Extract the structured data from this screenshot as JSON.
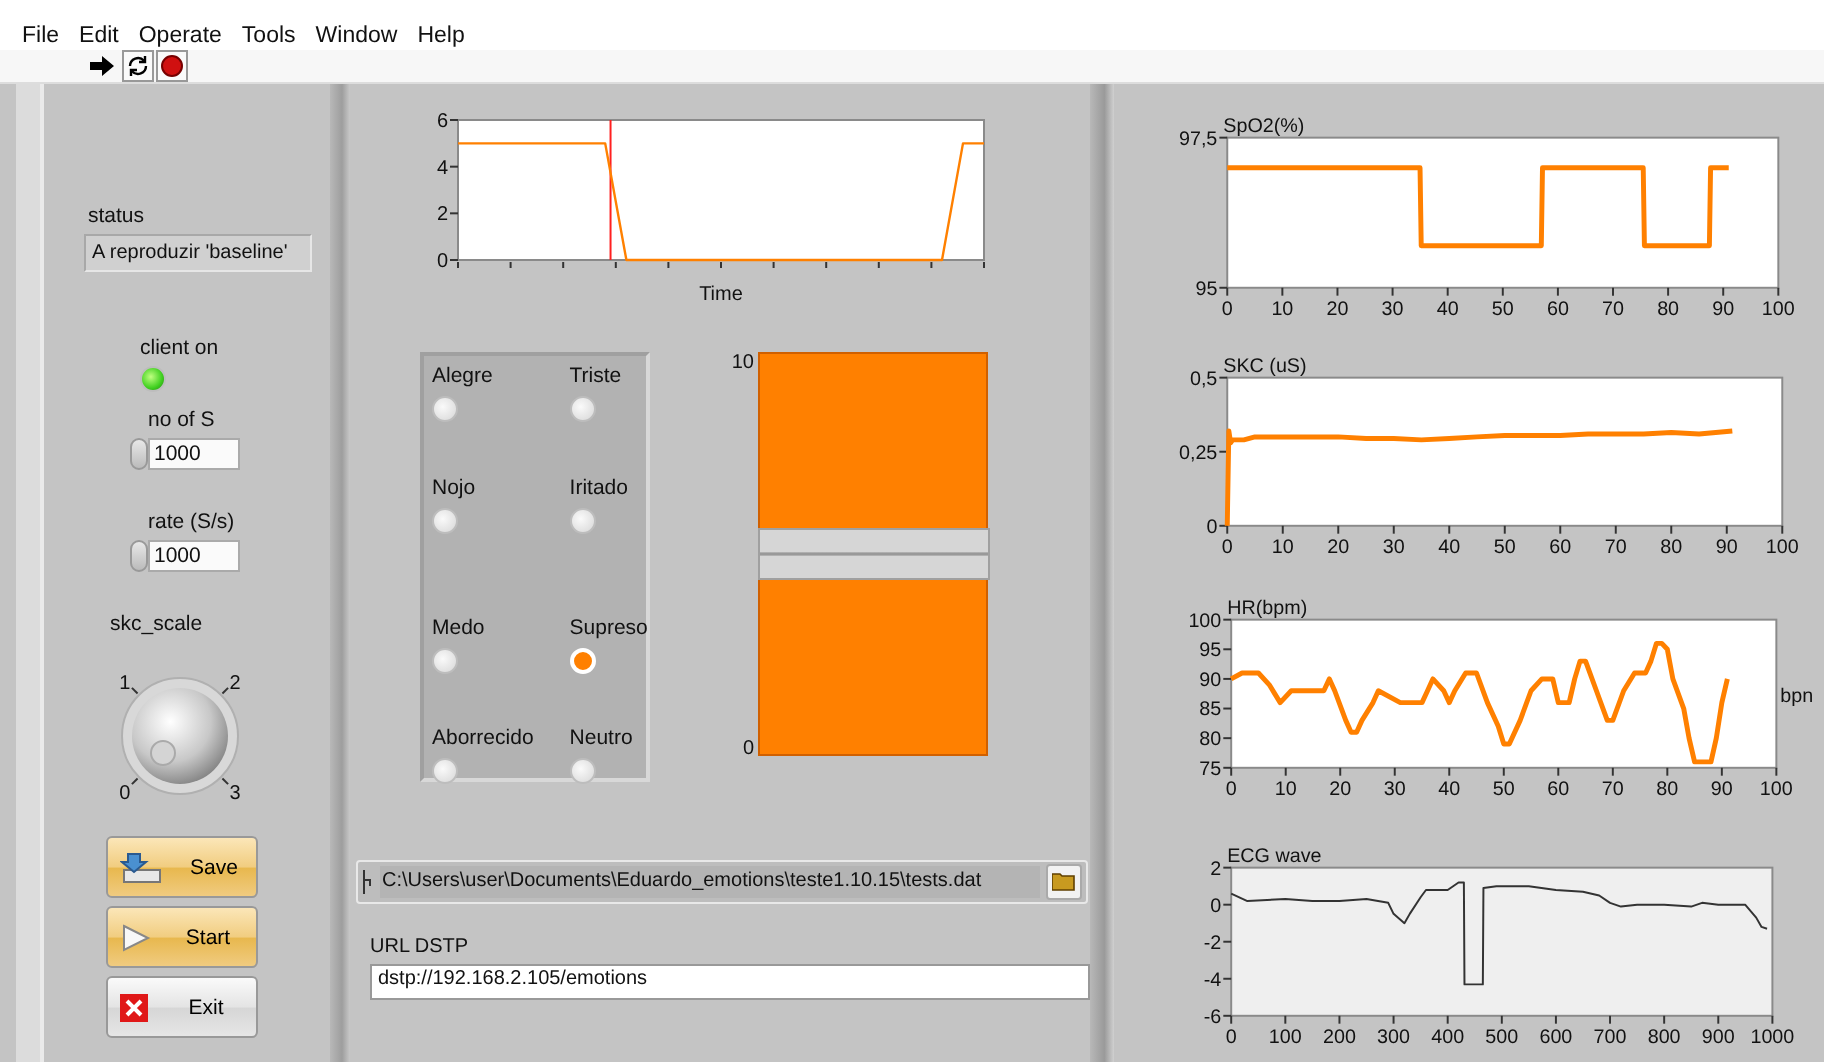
{
  "menu": [
    "File",
    "Edit",
    "Operate",
    "Tools",
    "Window",
    "Help"
  ],
  "toolbar": [
    {
      "kind": "run"
    },
    {
      "kind": "run-continuously"
    },
    {
      "kind": "abort"
    }
  ],
  "left_panel": {
    "status": {
      "label": "status",
      "value": "A reproduzir 'baseline'"
    },
    "client_led": {
      "label": "client on",
      "on": true
    },
    "numerics": [
      {
        "label": "no of S",
        "value": "1000"
      },
      {
        "label": "rate (S/s)",
        "value": "1000"
      }
    ],
    "knob": {
      "label": "skc_scale",
      "ticks": [
        "1",
        "2",
        "0",
        "3"
      ]
    },
    "buttons": [
      {
        "kind": "save",
        "label": "Save"
      },
      {
        "kind": "start",
        "label": "Start"
      },
      {
        "kind": "exit",
        "label": "Exit"
      }
    ]
  },
  "middle_panel": {
    "time_chart": {
      "chart_data": {
        "type": "line",
        "xlabel": "Time",
        "categories": [
          null,
          null,
          null,
          null,
          null,
          null,
          null,
          null,
          null,
          null,
          null,
          null,
          null,
          null,
          null,
          null,
          null,
          null,
          null,
          null,
          null,
          null,
          null,
          null,
          null,
          null
        ],
        "ylim": [
          0,
          6
        ],
        "yticks": [
          0,
          2,
          4,
          6
        ],
        "series": [
          {
            "color": "#ff8000",
            "values": [
              5,
              5,
              5,
              5,
              5,
              5,
              5,
              5,
              0,
              0,
              0,
              0,
              0,
              0,
              0,
              0,
              0,
              0,
              0,
              0,
              0,
              0,
              0,
              0,
              5,
              5
            ]
          }
        ]
      }
    },
    "emotions": [
      {
        "label": "Alegre",
        "on": false
      },
      {
        "label": "Triste",
        "on": false
      },
      {
        "label": "Nojo",
        "on": false
      },
      {
        "label": "Iritado",
        "on": false
      },
      {
        "label": "Medo",
        "on": false
      },
      {
        "label": "Supreso",
        "on": true
      },
      {
        "label": "Aborrecido",
        "on": false
      },
      {
        "label": "Neutro",
        "on": false
      }
    ],
    "slider": {
      "max_label": "10",
      "min_label": "0",
      "level": 0.5
    },
    "path": {
      "value": "C:\\Users\\user\\Documents\\Eduardo_emotions\\teste1.10.15\\tests.dat"
    },
    "url": {
      "label": "URL DSTP",
      "value": "dstp://192.168.2.105/emotions"
    }
  },
  "right_panel": {
    "charts": [
      {
        "chart_data": {
          "type": "line",
          "title": "SpO2(%)",
          "xlim": [
            0,
            100
          ],
          "ylim": [
            95,
            97.5
          ],
          "xticks": [
            0,
            10,
            20,
            30,
            40,
            50,
            60,
            70,
            80,
            90,
            100
          ],
          "yticks": [
            {
              "value": 95,
              "label": "95"
            },
            {
              "value": 97.5,
              "label": "97,5"
            }
          ],
          "series": [
            {
              "color": "#ff8000",
              "x": [
                0,
                35,
                35.2,
                57,
                57.2,
                75.5,
                75.7,
                87.5,
                87.7,
                91
              ],
              "values": [
                97,
                97,
                95.7,
                95.7,
                97,
                97,
                95.7,
                95.7,
                97,
                97
              ]
            }
          ]
        }
      },
      {
        "chart_data": {
          "type": "line",
          "title": "SKC (uS)",
          "xlim": [
            0,
            100
          ],
          "ylim": [
            0,
            0.5
          ],
          "xticks": [
            0,
            10,
            20,
            30,
            40,
            50,
            60,
            70,
            80,
            90,
            100
          ],
          "yticks": [
            {
              "value": 0,
              "label": "0"
            },
            {
              "value": 0.25,
              "label": "0,25"
            },
            {
              "value": 0.5,
              "label": "0,5"
            }
          ],
          "series": [
            {
              "color": "#ff8000",
              "x": [
                0,
                0.3,
                0.6,
                1,
                3,
                5,
                10,
                15,
                20,
                25,
                30,
                35,
                40,
                45,
                50,
                55,
                60,
                65,
                70,
                75,
                80,
                85,
                88,
                91
              ],
              "values": [
                0,
                0.32,
                0.28,
                0.29,
                0.29,
                0.3,
                0.3,
                0.3,
                0.3,
                0.295,
                0.295,
                0.29,
                0.295,
                0.3,
                0.305,
                0.305,
                0.305,
                0.31,
                0.31,
                0.31,
                0.315,
                0.31,
                0.315,
                0.32
              ]
            }
          ]
        }
      },
      {
        "chart_data": {
          "type": "line",
          "title": "HR(bpm)",
          "ylabel": "bpn",
          "xlim": [
            0,
            100
          ],
          "ylim": [
            75,
            100
          ],
          "xticks": [
            0,
            10,
            20,
            30,
            40,
            50,
            60,
            70,
            80,
            90,
            100
          ],
          "yticks": [
            75,
            80,
            85,
            90,
            95,
            100
          ],
          "series": [
            {
              "color": "#ff8000",
              "x": [
                0,
                2,
                5,
                7,
                9,
                11,
                17,
                18,
                19,
                21,
                22,
                23,
                24,
                26,
                27,
                31,
                35,
                36,
                37,
                39,
                40,
                41,
                43,
                45,
                47,
                49,
                50,
                51,
                53,
                55,
                57,
                59,
                60,
                62,
                63,
                64,
                65,
                67,
                69,
                70,
                72,
                74,
                76,
                77,
                78,
                79,
                80,
                81,
                83,
                84,
                85,
                88,
                89,
                90,
                91
              ],
              "values": [
                90,
                91,
                91,
                89,
                86,
                88,
                88,
                90,
                88,
                83,
                81,
                81,
                83,
                86,
                88,
                86,
                86,
                88,
                90,
                88,
                86,
                88,
                91,
                91,
                86,
                82,
                79,
                79,
                83,
                88,
                90,
                90,
                86,
                86,
                90,
                93,
                93,
                88,
                83,
                83,
                88,
                91,
                91,
                93,
                96,
                96,
                95,
                90,
                85,
                80,
                76,
                76,
                80,
                86,
                90
              ]
            }
          ]
        }
      },
      {
        "chart_data": {
          "type": "line",
          "title": "ECG wave",
          "xlim": [
            0,
            1000
          ],
          "ylim": [
            -6,
            2
          ],
          "xticks": [
            0,
            100,
            200,
            300,
            400,
            500,
            600,
            700,
            800,
            900,
            1000
          ],
          "yticks": [
            -6,
            -4,
            -2,
            0,
            2
          ],
          "series": [
            {
              "color": "#333333",
              "x": [
                0,
                30,
                100,
                150,
                200,
                250,
                290,
                300,
                320,
                330,
                350,
                360,
                400,
                420,
                430,
                431,
                465,
                466,
                490,
                550,
                600,
                650,
                680,
                700,
                720,
                750,
                800,
                850,
                870,
                900,
                950,
                970,
                980,
                990
              ],
              "values": [
                0.6,
                0.2,
                0.3,
                0.2,
                0.2,
                0.3,
                0.1,
                -0.5,
                -1,
                -0.5,
                0.4,
                0.8,
                0.8,
                1.2,
                1.2,
                -4.3,
                -4.3,
                0.9,
                1,
                1,
                0.8,
                0.7,
                0.5,
                0.1,
                -0.1,
                0,
                0,
                -0.1,
                0.1,
                0,
                0,
                -0.7,
                -1.2,
                -1.3
              ]
            }
          ]
        }
      }
    ]
  }
}
